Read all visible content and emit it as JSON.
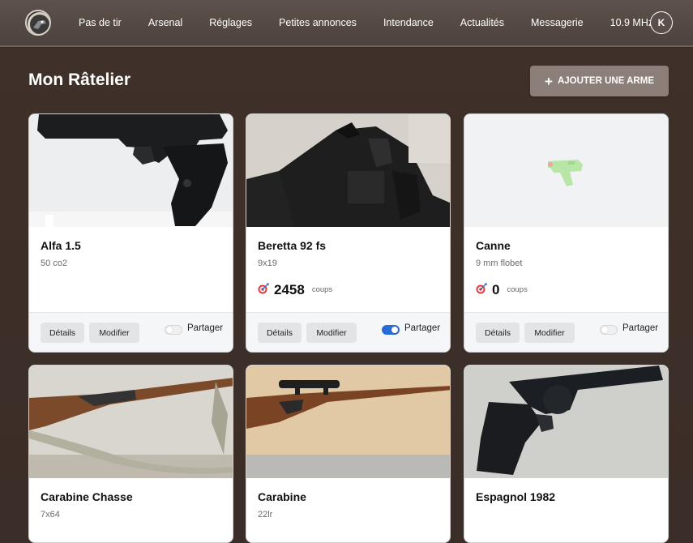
{
  "nav": {
    "items": [
      "Pas de tir",
      "Arsenal",
      "Réglages",
      "Petites annonces",
      "Intendance",
      "Actualités",
      "Messagerie",
      "10.9 MHz"
    ],
    "avatar": "K"
  },
  "page": {
    "title": "Mon Râtelier",
    "add_button": "AJOUTER UNE ARME"
  },
  "cards": [
    {
      "name": "Alfa 1.5",
      "caliber": "50 co2",
      "shots": null,
      "shots_unit": "",
      "details": "Détails",
      "edit": "Modifier",
      "share": "Partager",
      "shared": false
    },
    {
      "name": "Beretta 92 fs",
      "caliber": "9x19",
      "shots": "2458",
      "shots_unit": "coups",
      "details": "Détails",
      "edit": "Modifier",
      "share": "Partager",
      "shared": true
    },
    {
      "name": "Canne",
      "caliber": "9 mm flobet",
      "shots": "0",
      "shots_unit": "coups",
      "details": "Détails",
      "edit": "Modifier",
      "share": "Partager",
      "shared": false
    },
    {
      "name": "Carabine Chasse",
      "caliber": "7x64"
    },
    {
      "name": "Carabine",
      "caliber": "22lr"
    },
    {
      "name": "Espagnol 1982",
      "caliber": ""
    }
  ]
}
